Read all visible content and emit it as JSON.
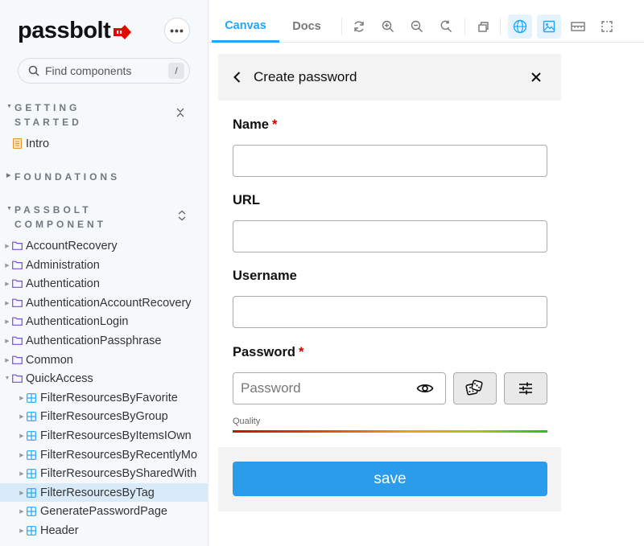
{
  "app": {
    "logo_text": "passbolt"
  },
  "sidebar": {
    "search_placeholder": "Find components",
    "search_shortcut": "/",
    "sections": [
      {
        "line1": "GETTING",
        "line2": "STARTED"
      },
      {
        "line1": "FOUNDATIONS"
      },
      {
        "line1": "PASSBOLT",
        "line2": "COMPONENT"
      }
    ],
    "intro": "Intro",
    "groups": [
      "AccountRecovery",
      "Administration",
      "Authentication",
      "AuthenticationAccountRecovery",
      "AuthenticationLogin",
      "AuthenticationPassphrase",
      "Common",
      "QuickAccess"
    ],
    "quickaccess_items": [
      "FilterResourcesByFavorite",
      "FilterResourcesByGroup",
      "FilterResourcesByItemsIOwn",
      "FilterResourcesByRecentlyMo",
      "FilterResourcesBySharedWith",
      "FilterResourcesByTag",
      "GeneratePasswordPage",
      "Header"
    ],
    "selected_item": "FilterResourcesByTag"
  },
  "toolbar": {
    "tabs": [
      "Canvas",
      "Docs"
    ],
    "active_tab": "Canvas",
    "icons": [
      "reload-icon",
      "zoom-in-icon",
      "zoom-out-icon",
      "reset-zoom-icon",
      "outline-icon",
      "globe-icon",
      "background-image-icon",
      "ruler-icon",
      "frame-icon"
    ]
  },
  "dialog": {
    "title": "Create password",
    "fields": {
      "name_label": "Name",
      "url_label": "URL",
      "username_label": "Username",
      "password_label": "Password",
      "required_mark": "*",
      "password_placeholder": "Password"
    },
    "quality_label": "Quality",
    "save_label": "save"
  },
  "colors": {
    "accent": "#1ea7fd",
    "save_button": "#2a9ceb",
    "required": "#d40101",
    "selected_item_bg": "#d9ebf9",
    "logo_red": "#e10600"
  }
}
